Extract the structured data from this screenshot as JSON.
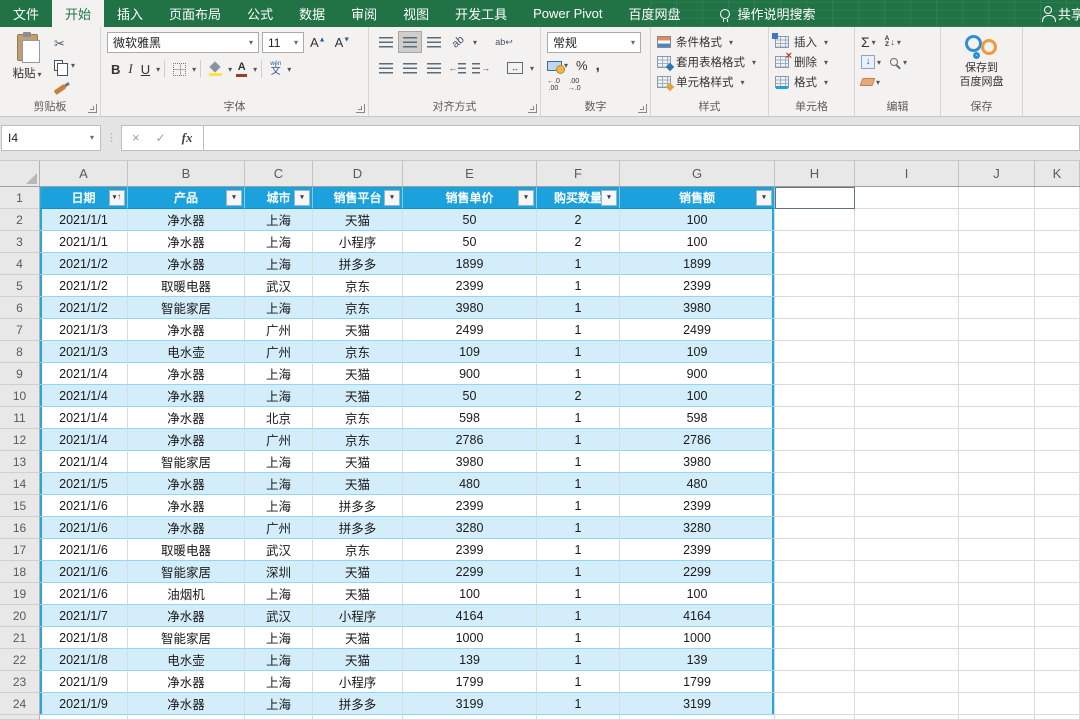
{
  "titlebar": {
    "tabs": [
      "文件",
      "开始",
      "插入",
      "页面布局",
      "公式",
      "数据",
      "审阅",
      "视图",
      "开发工具",
      "Power Pivot",
      "百度网盘"
    ],
    "active_index": 1,
    "search": "操作说明搜索",
    "share": "共享"
  },
  "ribbon": {
    "clipboard": {
      "label": "剪贴板",
      "paste": "粘贴"
    },
    "font": {
      "label": "字体",
      "font_name": "微软雅黑",
      "font_size": "11",
      "bold": "B",
      "italic": "I",
      "underline": "U",
      "wen_pinyin": "wén",
      "wen_zi": "文",
      "size_up": "A",
      "size_down": "A"
    },
    "alignment": {
      "label": "对齐方式",
      "orientation": "ab",
      "wrap": "ab↩"
    },
    "number": {
      "label": "数字",
      "format": "常规",
      "percent": "%",
      "comma": ",",
      "inc_decimal": "←.0\n.00",
      "dec_decimal": ".00\n→.0"
    },
    "styles": {
      "label": "样式",
      "items": [
        "条件格式",
        "套用表格格式",
        "单元格样式"
      ]
    },
    "cells": {
      "label": "单元格",
      "items": [
        "插入",
        "删除",
        "格式"
      ]
    },
    "editing": {
      "label": "编辑",
      "sigma": "Σ",
      "sort_az": "A\nZ"
    },
    "save": {
      "label": "保存",
      "button_lines": [
        "保存到",
        "百度网盘"
      ]
    }
  },
  "formula_bar": {
    "name_box": "I4",
    "cancel": "×",
    "enter": "✓",
    "fx": "fx",
    "formula": ""
  },
  "sheet": {
    "columns": [
      "A",
      "B",
      "C",
      "D",
      "E",
      "F",
      "G",
      "H",
      "I",
      "J",
      "K"
    ],
    "first_row": 1,
    "table": {
      "headers": [
        "日期",
        "产品",
        "城市",
        "销售平台",
        "销售单价",
        "购买数量",
        "销售额"
      ],
      "sorted_header_index": 0,
      "sort_direction": "asc",
      "rows": [
        [
          "2021/1/1",
          "净水器",
          "上海",
          "天猫",
          "50",
          "2",
          "100"
        ],
        [
          "2021/1/1",
          "净水器",
          "上海",
          "小程序",
          "50",
          "2",
          "100"
        ],
        [
          "2021/1/2",
          "净水器",
          "上海",
          "拼多多",
          "1899",
          "1",
          "1899"
        ],
        [
          "2021/1/2",
          "取暖电器",
          "武汉",
          "京东",
          "2399",
          "1",
          "2399"
        ],
        [
          "2021/1/2",
          "智能家居",
          "上海",
          "京东",
          "3980",
          "1",
          "3980"
        ],
        [
          "2021/1/3",
          "净水器",
          "广州",
          "天猫",
          "2499",
          "1",
          "2499"
        ],
        [
          "2021/1/3",
          "电水壶",
          "广州",
          "京东",
          "109",
          "1",
          "109"
        ],
        [
          "2021/1/4",
          "净水器",
          "上海",
          "天猫",
          "900",
          "1",
          "900"
        ],
        [
          "2021/1/4",
          "净水器",
          "上海",
          "天猫",
          "50",
          "2",
          "100"
        ],
        [
          "2021/1/4",
          "净水器",
          "北京",
          "京东",
          "598",
          "1",
          "598"
        ],
        [
          "2021/1/4",
          "净水器",
          "广州",
          "京东",
          "2786",
          "1",
          "2786"
        ],
        [
          "2021/1/4",
          "智能家居",
          "上海",
          "天猫",
          "3980",
          "1",
          "3980"
        ],
        [
          "2021/1/5",
          "净水器",
          "上海",
          "天猫",
          "480",
          "1",
          "480"
        ],
        [
          "2021/1/6",
          "净水器",
          "上海",
          "拼多多",
          "2399",
          "1",
          "2399"
        ],
        [
          "2021/1/6",
          "净水器",
          "广州",
          "拼多多",
          "3280",
          "1",
          "3280"
        ],
        [
          "2021/1/6",
          "取暖电器",
          "武汉",
          "京东",
          "2399",
          "1",
          "2399"
        ],
        [
          "2021/1/6",
          "智能家居",
          "深圳",
          "天猫",
          "2299",
          "1",
          "2299"
        ],
        [
          "2021/1/6",
          "油烟机",
          "上海",
          "天猫",
          "100",
          "1",
          "100"
        ],
        [
          "2021/1/7",
          "净水器",
          "武汉",
          "小程序",
          "4164",
          "1",
          "4164"
        ],
        [
          "2021/1/8",
          "智能家居",
          "上海",
          "天猫",
          "1000",
          "1",
          "1000"
        ],
        [
          "2021/1/8",
          "电水壶",
          "上海",
          "天猫",
          "139",
          "1",
          "139"
        ],
        [
          "2021/1/9",
          "净水器",
          "上海",
          "小程序",
          "1799",
          "1",
          "1799"
        ],
        [
          "2021/1/9",
          "净水器",
          "上海",
          "拼多多",
          "3199",
          "1",
          "3199"
        ]
      ]
    },
    "colors": {
      "header_fill": "#1BA2DC",
      "band_fill": "#D3EDFA",
      "ribbon_green": "#217346"
    }
  }
}
